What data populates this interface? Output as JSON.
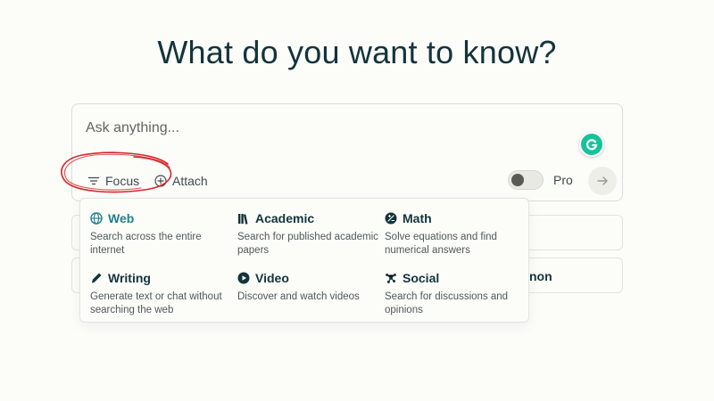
{
  "heading": "What do you want to know?",
  "search": {
    "placeholder": "Ask anything...",
    "focus_label": "Focus",
    "attach_label": "Attach",
    "pro_label": "Pro",
    "pro_enabled": false
  },
  "focus_options": [
    {
      "label": "Web",
      "description": "Search across the entire internet",
      "icon": "globe-icon",
      "selected": true
    },
    {
      "label": "Academic",
      "description": "Search for published academic papers",
      "icon": "books-icon",
      "selected": false
    },
    {
      "label": "Math",
      "description": "Solve equations and find numerical answers",
      "icon": "math-icon",
      "selected": false
    },
    {
      "label": "Writing",
      "description": "Generate text or chat without searching the web",
      "icon": "pencil-icon",
      "selected": false
    },
    {
      "label": "Video",
      "description": "Discover and watch videos",
      "icon": "play-icon",
      "selected": false
    },
    {
      "label": "Social",
      "description": "Search for discussions and opinions",
      "icon": "network-icon",
      "selected": false
    }
  ],
  "background_suggestion_fragment": "non",
  "colors": {
    "accent": "#1f7f8f",
    "text": "#13343b",
    "background": "#fcfcf9",
    "annotation_red": "#d6262b"
  }
}
